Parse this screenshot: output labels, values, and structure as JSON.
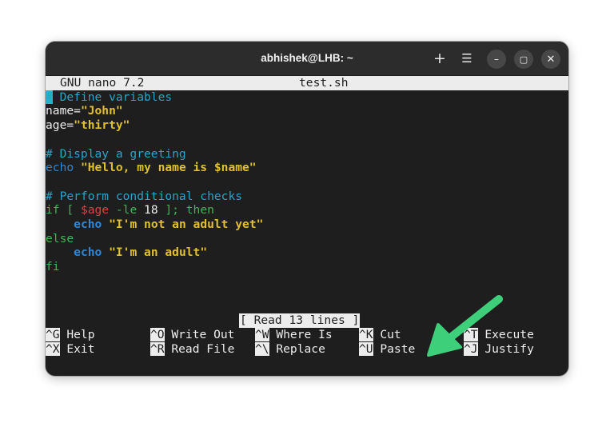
{
  "window": {
    "title": "abhishek@LHB: ~",
    "buttons": {
      "new_tab": "+",
      "menu": "☰",
      "minimize": "–",
      "maximize": "▢",
      "close": "✕"
    }
  },
  "nano": {
    "version": "GNU nano 7.2",
    "filename": "test.sh",
    "status": "[ Read 13 lines ]"
  },
  "code": {
    "l1_cursor": "#",
    "l1_rest": " Define variables",
    "l2_name": "name=",
    "l2_val": "\"John\"",
    "l3_name": "age=",
    "l3_val": "\"thirty\"",
    "l5": "# Display a greeting",
    "l6_kw": "echo",
    "l6_str": " \"Hello, my name is $name\"",
    "l8": "# Perform conditional checks",
    "l9_a": "if [ ",
    "l9_var": "$age",
    "l9_b": " -le ",
    "l9_num": "18",
    "l9_c": " ]; then",
    "l10_indent": "    ",
    "l10_kw": "echo",
    "l10_str": " \"I'm not an adult yet\"",
    "l11": "else",
    "l12_indent": "    ",
    "l12_kw": "echo",
    "l12_str": " \"I'm an adult\"",
    "l13": "fi"
  },
  "shortcuts": [
    {
      "key": "^G",
      "label": " Help"
    },
    {
      "key": "^O",
      "label": " Write Out"
    },
    {
      "key": "^W",
      "label": " Where Is"
    },
    {
      "key": "^K",
      "label": " Cut"
    },
    {
      "key": "^T",
      "label": " Execute"
    },
    {
      "key": "^X",
      "label": " Exit"
    },
    {
      "key": "^R",
      "label": " Read File"
    },
    {
      "key": "^\\",
      "label": " Replace"
    },
    {
      "key": "^U",
      "label": " Paste"
    },
    {
      "key": "^J",
      "label": " Justify"
    }
  ],
  "colors": {
    "comment": "#2aa3c9",
    "keyword": "#2d87d6",
    "string": "#e0c02c",
    "control": "#40b35a",
    "variable": "#d14545",
    "arrow": "#3ecf7a"
  }
}
